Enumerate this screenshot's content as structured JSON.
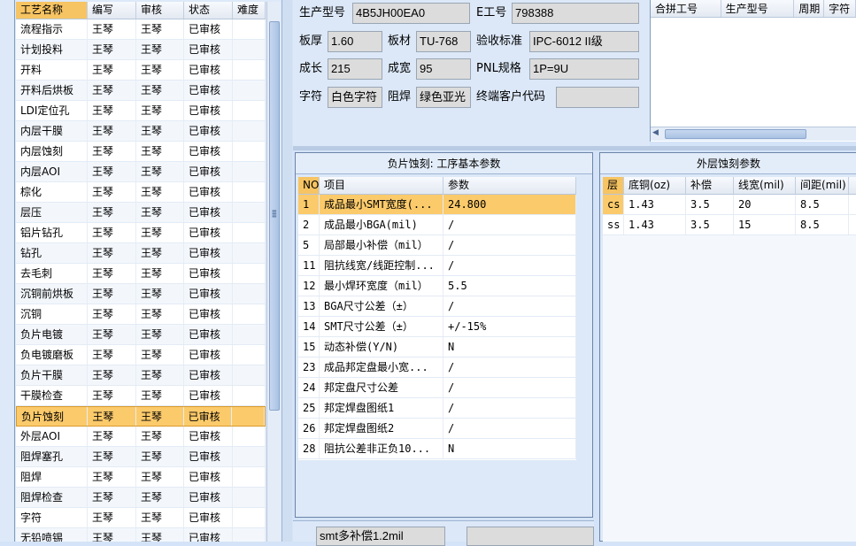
{
  "process_list": {
    "headers": [
      "工艺名称",
      "编写",
      "审核",
      "状态",
      "难度"
    ],
    "selected_index": 19,
    "rows": [
      [
        "流程指示",
        "王琴",
        "王琴",
        "已审核",
        ""
      ],
      [
        "计划投料",
        "王琴",
        "王琴",
        "已审核",
        ""
      ],
      [
        "开料",
        "王琴",
        "王琴",
        "已审核",
        ""
      ],
      [
        "开料后烘板",
        "王琴",
        "王琴",
        "已审核",
        ""
      ],
      [
        "LDI定位孔",
        "王琴",
        "王琴",
        "已审核",
        ""
      ],
      [
        "内层干膜",
        "王琴",
        "王琴",
        "已审核",
        ""
      ],
      [
        "内层蚀刻",
        "王琴",
        "王琴",
        "已审核",
        ""
      ],
      [
        "内层AOI",
        "王琴",
        "王琴",
        "已审核",
        ""
      ],
      [
        "棕化",
        "王琴",
        "王琴",
        "已审核",
        ""
      ],
      [
        "层压",
        "王琴",
        "王琴",
        "已审核",
        ""
      ],
      [
        "铝片钻孔",
        "王琴",
        "王琴",
        "已审核",
        ""
      ],
      [
        "钻孔",
        "王琴",
        "王琴",
        "已审核",
        ""
      ],
      [
        "去毛刺",
        "王琴",
        "王琴",
        "已审核",
        ""
      ],
      [
        "沉铜前烘板",
        "王琴",
        "王琴",
        "已审核",
        ""
      ],
      [
        "沉铜",
        "王琴",
        "王琴",
        "已审核",
        ""
      ],
      [
        "负片电镀",
        "王琴",
        "王琴",
        "已审核",
        ""
      ],
      [
        "负电镀磨板",
        "王琴",
        "王琴",
        "已审核",
        ""
      ],
      [
        "负片干膜",
        "王琴",
        "王琴",
        "已审核",
        ""
      ],
      [
        "干膜检查",
        "王琴",
        "王琴",
        "已审核",
        ""
      ],
      [
        "负片蚀刻",
        "王琴",
        "王琴",
        "已审核",
        ""
      ],
      [
        "外层AOI",
        "王琴",
        "王琴",
        "已审核",
        ""
      ],
      [
        "阻焊塞孔",
        "王琴",
        "王琴",
        "已审核",
        ""
      ],
      [
        "阻焊",
        "王琴",
        "王琴",
        "已审核",
        ""
      ],
      [
        "阻焊检查",
        "王琴",
        "王琴",
        "已审核",
        ""
      ],
      [
        "字符",
        "王琴",
        "王琴",
        "已审核",
        ""
      ],
      [
        "无铅喷锡",
        "王琴",
        "王琴",
        "已审核",
        ""
      ]
    ]
  },
  "form": {
    "product_model_label": "生产型号",
    "product_model": "4B5JH00EA0",
    "e_no_label": "E工号",
    "e_no": "798388",
    "thickness_label": "板厚",
    "thickness": "1.60",
    "material_label": "板材",
    "material": "TU-768",
    "standard_label": "验收标准",
    "standard": "IPC-6012 II级",
    "length_label": "成长",
    "length": "215",
    "width_label": "成宽",
    "width": "95",
    "pnl_label": "PNL规格",
    "pnl": "1P=9U",
    "silkscreen_label": "字符",
    "silkscreen": "白色字符",
    "soldermask_label": "阻焊",
    "soldermask": "绿色亚光",
    "customer_code_label": "终端客户代码",
    "customer_code": ""
  },
  "merge_grid": {
    "headers": [
      "合拼工号",
      "生产型号",
      "周期",
      "字符"
    ]
  },
  "basic_params": {
    "title": "负片蚀刻: 工序基本参数",
    "headers": [
      "NO",
      "项目",
      "参数"
    ],
    "selected_index": 0,
    "rows": [
      [
        "1",
        "成品最小SMT宽度(...",
        "24.800"
      ],
      [
        "2",
        "成品最小BGA(mil)",
        "/"
      ],
      [
        "5",
        "局部最小补偿（mil）",
        "/"
      ],
      [
        "11",
        "阻抗线宽/线距控制...",
        "/"
      ],
      [
        "12",
        "最小焊环宽度（mil）",
        "5.5"
      ],
      [
        "13",
        "BGA尺寸公差（±）",
        "/"
      ],
      [
        "14",
        "SMT尺寸公差（±）",
        "+/-15%"
      ],
      [
        "15",
        "动态补偿(Y/N)",
        "N"
      ],
      [
        "23",
        "成品邦定盘最小宽...",
        "/"
      ],
      [
        "24",
        "邦定盘尺寸公差",
        "/"
      ],
      [
        "25",
        "邦定焊盘图纸1",
        "/"
      ],
      [
        "26",
        "邦定焊盘图纸2",
        "/"
      ],
      [
        "28",
        "阻抗公差非正负10...",
        "N"
      ]
    ]
  },
  "outer_params": {
    "title": "外层蚀刻参数",
    "headers": [
      "层",
      "底铜(oz)",
      "补偿",
      "线宽(mil)",
      "间距(mil)"
    ],
    "selected_index": 0,
    "rows": [
      [
        "cs",
        "1.43",
        "3.5",
        "20",
        "8.5"
      ],
      [
        "ss",
        "1.43",
        "3.5",
        "15",
        "8.5"
      ]
    ]
  },
  "bottom": {
    "note": "smt多补偿1.2mil",
    "note2": ""
  }
}
